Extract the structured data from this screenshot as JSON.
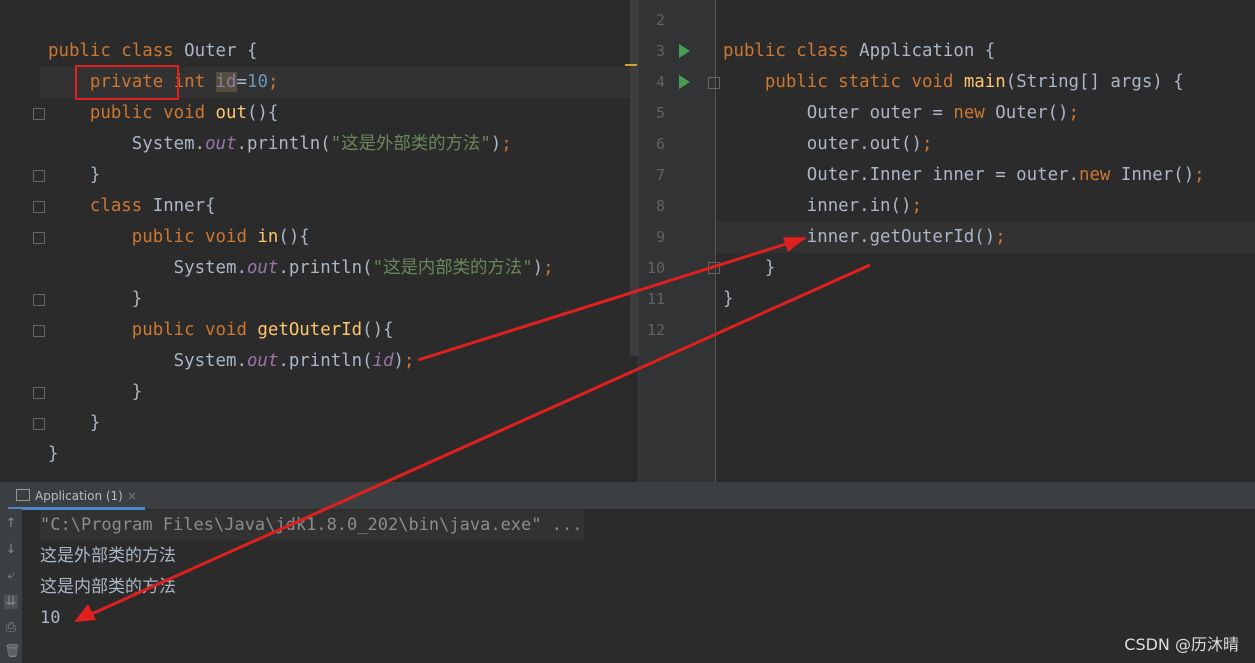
{
  "left_editor": {
    "lines": [
      {
        "t": [
          [
            "public class ",
            "k"
          ],
          [
            "Outer {",
            ""
          ]
        ]
      },
      {
        "t": [
          [
            "    ",
            ""
          ],
          [
            "private ",
            "k"
          ],
          [
            "int ",
            "k"
          ],
          [
            "id",
            "hl"
          ],
          [
            "=",
            ""
          ],
          [
            "10",
            "n"
          ],
          [
            ";",
            "k"
          ]
        ]
      },
      {
        "t": [
          [
            "    ",
            ""
          ],
          [
            "public void ",
            "k"
          ],
          [
            "out",
            "m"
          ],
          [
            "(){",
            ""
          ]
        ]
      },
      {
        "t": [
          [
            "        System.",
            ""
          ],
          [
            "out",
            "f"
          ],
          [
            ".println(",
            ""
          ],
          [
            "\"这是外部类的方法\"",
            "s"
          ],
          [
            ")",
            ""
          ],
          [
            ";",
            "k"
          ]
        ]
      },
      {
        "t": [
          [
            "    }",
            ""
          ]
        ]
      },
      {
        "t": [
          [
            "    ",
            ""
          ],
          [
            "class ",
            "k"
          ],
          [
            "Inner{",
            ""
          ]
        ]
      },
      {
        "t": [
          [
            "        ",
            ""
          ],
          [
            "public void ",
            "k"
          ],
          [
            "in",
            "m"
          ],
          [
            "(){",
            ""
          ]
        ]
      },
      {
        "t": [
          [
            "            System.",
            ""
          ],
          [
            "out",
            "f"
          ],
          [
            ".println(",
            ""
          ],
          [
            "\"这是内部类的方法\"",
            "s"
          ],
          [
            ")",
            ""
          ],
          [
            ";",
            "k"
          ]
        ]
      },
      {
        "t": [
          [
            "        }",
            ""
          ]
        ]
      },
      {
        "t": [
          [
            "        ",
            ""
          ],
          [
            "public void ",
            "k"
          ],
          [
            "getOuterId",
            "m"
          ],
          [
            "(){",
            ""
          ]
        ]
      },
      {
        "t": [
          [
            "            System.",
            ""
          ],
          [
            "out",
            "f"
          ],
          [
            ".println(",
            ""
          ],
          [
            "id",
            "f"
          ],
          [
            ")",
            ""
          ],
          [
            ";",
            "k"
          ]
        ]
      },
      {
        "t": [
          [
            "        }",
            ""
          ]
        ]
      },
      {
        "t": [
          [
            "    }",
            ""
          ]
        ]
      },
      {
        "t": [
          [
            "}",
            ""
          ]
        ]
      }
    ]
  },
  "right_editor": {
    "line_numbers": [
      "2",
      "3",
      "4",
      "5",
      "6",
      "7",
      "8",
      "9",
      "10",
      "11",
      "12"
    ],
    "lines": [
      {
        "t": []
      },
      {
        "t": [
          [
            "public class ",
            "k"
          ],
          [
            "Application {",
            ""
          ]
        ]
      },
      {
        "t": [
          [
            "    ",
            ""
          ],
          [
            "public static void ",
            "k"
          ],
          [
            "main",
            "m"
          ],
          [
            "(String[] args) {",
            ""
          ]
        ]
      },
      {
        "t": [
          [
            "        Outer outer = ",
            ""
          ],
          [
            "new ",
            "k"
          ],
          [
            "Outer()",
            ""
          ],
          [
            ";",
            "k"
          ]
        ]
      },
      {
        "t": [
          [
            "        outer.out()",
            ""
          ],
          [
            ";",
            "k"
          ]
        ]
      },
      {
        "t": [
          [
            "        Outer.Inner inner = outer.",
            ""
          ],
          [
            "new ",
            "k"
          ],
          [
            "Inner()",
            ""
          ],
          [
            ";",
            "k"
          ]
        ]
      },
      {
        "t": [
          [
            "        inner.in()",
            ""
          ],
          [
            ";",
            "k"
          ]
        ]
      },
      {
        "t": [
          [
            "        inner.getOuterId()",
            ""
          ],
          [
            ";",
            "k"
          ]
        ]
      },
      {
        "t": [
          [
            "    }",
            ""
          ]
        ]
      },
      {
        "t": [
          [
            "}",
            ""
          ]
        ]
      },
      {
        "t": []
      }
    ]
  },
  "run_panel": {
    "tab_label": "Application (1)",
    "close": "×",
    "output": [
      "\"C:\\Program Files\\Java\\jdk1.8.0_202\\bin\\java.exe\" ...",
      "这是外部类的方法",
      "这是内部类的方法",
      "10"
    ]
  },
  "watermark": "CSDN @历沐晴",
  "colors": {
    "annotation": "#e0201f",
    "keyword": "#cc7832",
    "string": "#6a8759",
    "number": "#6897bb"
  }
}
